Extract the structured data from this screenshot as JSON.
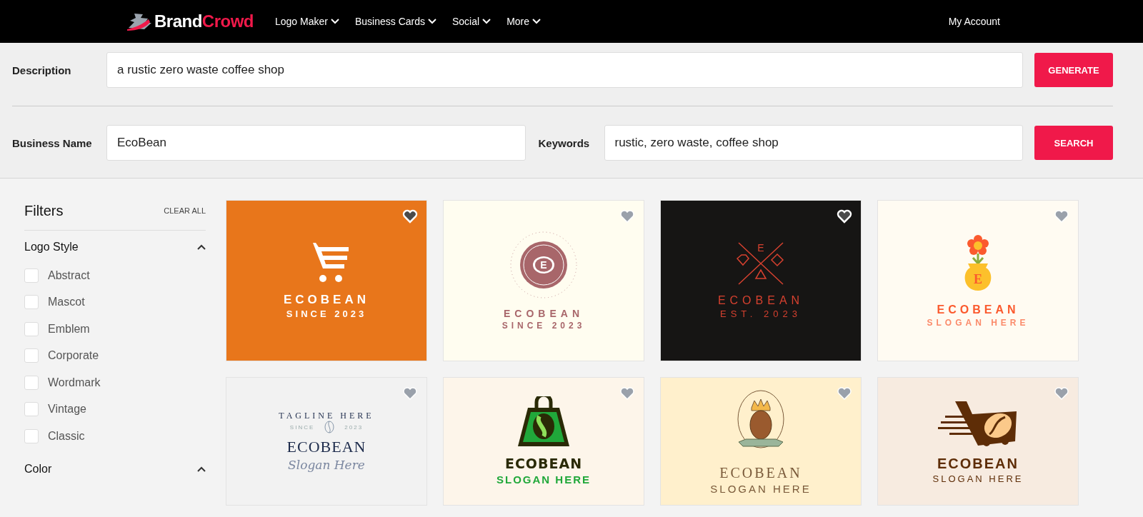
{
  "nav": {
    "brand_first": "Brand",
    "brand_second": "Crowd",
    "links": [
      "Logo Maker",
      "Business Cards",
      "Social",
      "More"
    ],
    "account": "My Account"
  },
  "search": {
    "description_label": "Description",
    "description_value": "a rustic zero waste coffee shop",
    "generate": "GENERATE",
    "name_label": "Business Name",
    "name_value": "EcoBean",
    "keywords_label": "Keywords",
    "keywords_value": "rustic, zero waste, coffee shop",
    "search": "SEARCH"
  },
  "filters": {
    "title": "Filters",
    "clear": "CLEAR ALL",
    "sections": [
      {
        "title": "Logo Style",
        "expanded": true,
        "options": [
          {
            "label": "Abstract",
            "checked": false
          },
          {
            "label": "Mascot",
            "checked": false
          },
          {
            "label": "Emblem",
            "checked": false
          },
          {
            "label": "Corporate",
            "checked": false
          },
          {
            "label": "Wordmark",
            "checked": false
          },
          {
            "label": "Vintage",
            "checked": false
          },
          {
            "label": "Classic",
            "checked": false
          }
        ]
      },
      {
        "title": "Color",
        "expanded": true
      }
    ]
  },
  "logos": [
    {
      "kind": "cart",
      "color": "#e8761b",
      "name": "ECOBEAN",
      "tagline": "SINCE 2023"
    },
    {
      "kind": "emblem",
      "color": "#fffdf0",
      "monogram": "E",
      "name": "ECOBEAN",
      "tagline": "SINCE 2023"
    },
    {
      "kind": "arrows",
      "color": "#161514",
      "monogram": "E",
      "name": "ECOBEAN",
      "tagline": "EST. 2023"
    },
    {
      "kind": "flower",
      "color": "#fffbf2",
      "monogram": "E",
      "name": "ECOBEAN",
      "tagline": "SLOGAN HERE"
    },
    {
      "kind": "badge",
      "color": "#f2f2f2",
      "arc": "TAGLINE HERE",
      "since": "SINCE",
      "year": "2023",
      "name": "ECOBEAN",
      "tagline": "Slogan Here"
    },
    {
      "kind": "bag",
      "color": "#fdf5ea",
      "name": "ECOBEAN",
      "tagline": "SLOGAN HERE"
    },
    {
      "kind": "crown",
      "color": "#fff0cc",
      "name": "ECOBEAN",
      "tagline": "SLOGAN HERE"
    },
    {
      "kind": "speedcart",
      "color": "#f7ebe0",
      "name": "ECOBEAN",
      "tagline": "SLOGAN HERE"
    }
  ]
}
